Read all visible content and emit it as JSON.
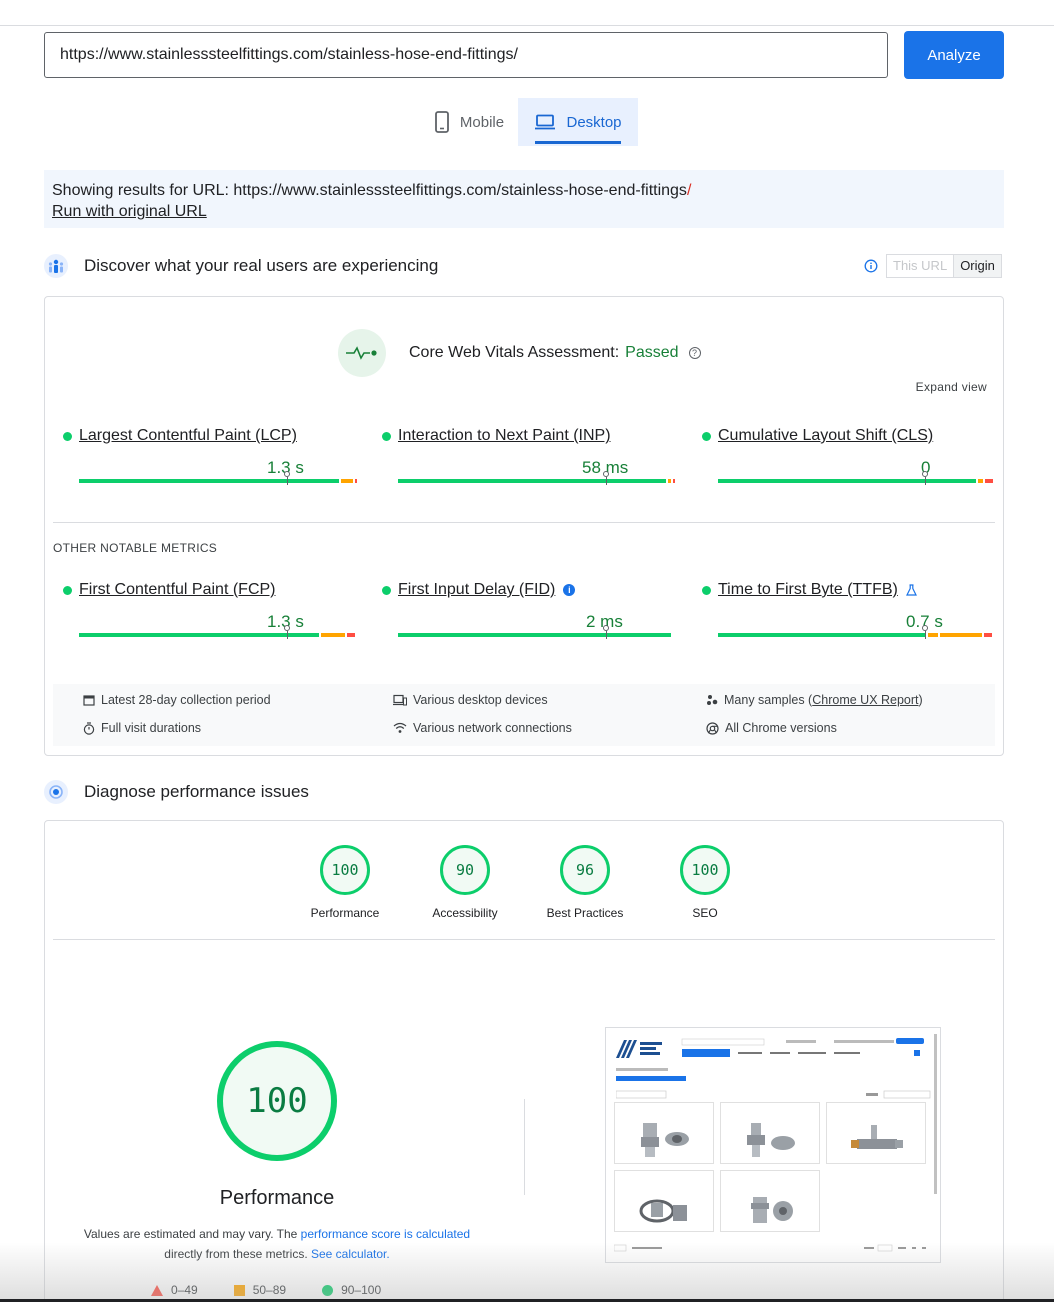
{
  "search": {
    "url_value": "https://www.stainlesssteelfittings.com/stainless-hose-end-fittings/",
    "analyze_label": "Analyze"
  },
  "device_tabs": {
    "mobile": "Mobile",
    "desktop": "Desktop",
    "selected": "Desktop"
  },
  "notice": {
    "prefix": "Showing results for URL: ",
    "url": "https://www.stainlesssteelfittings.com/stainless-hose-end-fittings",
    "slash": "/",
    "run_original": "Run with original URL"
  },
  "field_section": {
    "title": "Discover what your real users are experiencing",
    "this_url": "This URL",
    "origin": "Origin",
    "assessment_label": "Core Web Vitals Assessment: ",
    "assessment_result": "Passed",
    "expand_view": "Expand view",
    "core_metrics": [
      {
        "name": "Largest Contentful Paint (LCP)",
        "value": "1.3 s"
      },
      {
        "name": "Interaction to Next Paint (INP)",
        "value": "58 ms"
      },
      {
        "name": "Cumulative Layout Shift (CLS)",
        "value": "0"
      }
    ],
    "other_label": "OTHER NOTABLE METRICS",
    "other_metrics": [
      {
        "name": "First Contentful Paint (FCP)",
        "value": "1.3 s"
      },
      {
        "name": "First Input Delay (FID)",
        "value": "2 ms"
      },
      {
        "name": "Time to First Byte (TTFB)",
        "value": "0.7 s"
      }
    ],
    "footer": {
      "period": "Latest 28-day collection period",
      "devices": "Various desktop devices",
      "samples_prefix": "Many samples (",
      "samples_link": "Chrome UX Report",
      "samples_suffix": ")",
      "durations": "Full visit durations",
      "network": "Various network connections",
      "versions": "All Chrome versions"
    }
  },
  "lab_section": {
    "title": "Diagnose performance issues",
    "scores": [
      {
        "label": "Performance",
        "score": "100"
      },
      {
        "label": "Accessibility",
        "score": "90"
      },
      {
        "label": "Best Practices",
        "score": "96"
      },
      {
        "label": "SEO",
        "score": "100"
      }
    ],
    "big_score": "100",
    "big_label": "Performance",
    "est_prefix": "Values are estimated and may vary. The ",
    "est_link1": "performance score is calculated",
    "est_mid": " directly from these metrics. ",
    "est_link2": "See calculator.",
    "legend": [
      {
        "range": "0–49",
        "color": "#ff4e42"
      },
      {
        "range": "50–89",
        "color": "#ffa400"
      },
      {
        "range": "90–100",
        "color": "#0cce6b"
      }
    ]
  },
  "colors": {
    "accent": "#1a73e8",
    "good": "#0cce6b",
    "average": "#ffa400",
    "poor": "#ff4e42",
    "passed_text": "#188038"
  }
}
